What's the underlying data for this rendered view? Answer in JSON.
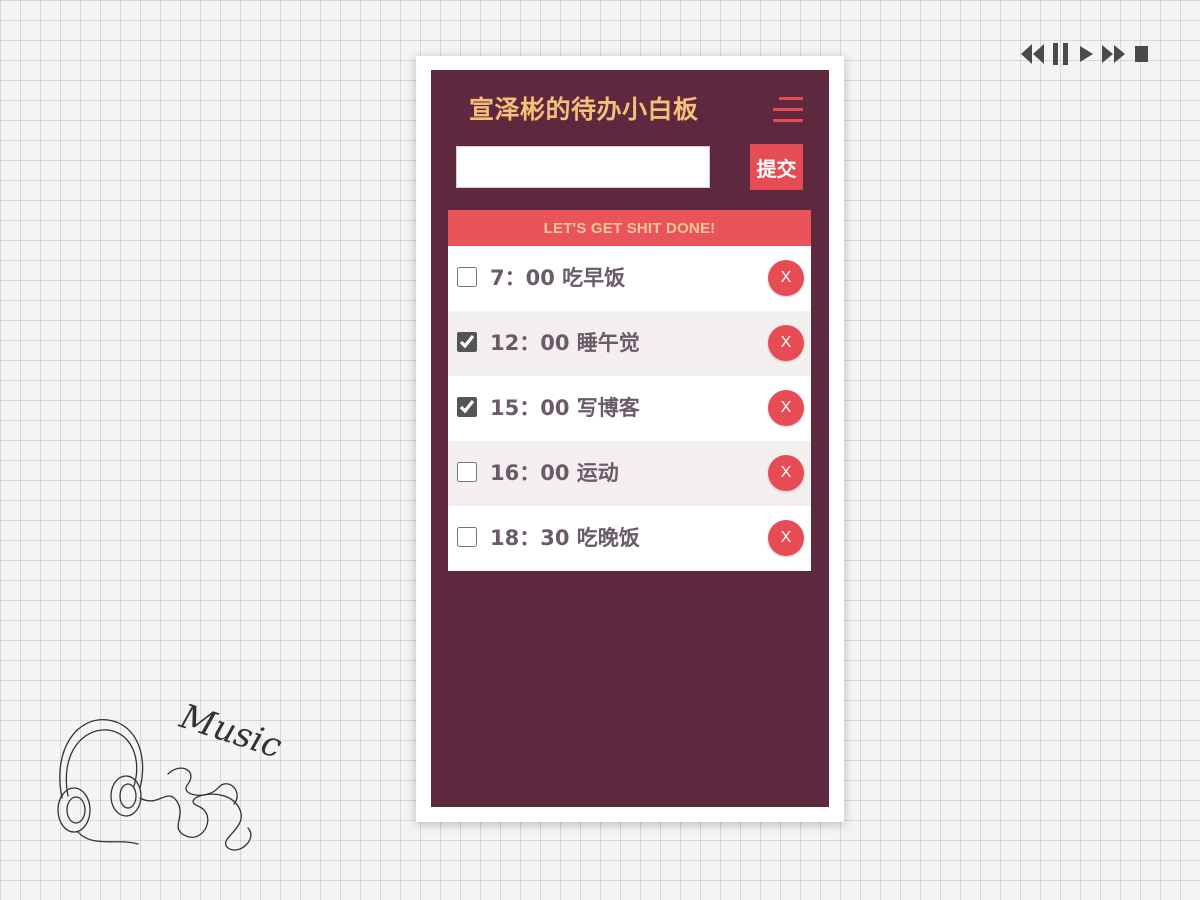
{
  "app": {
    "title": "宣泽彬的待办小白板",
    "input_placeholder": "",
    "submit_label": "提交",
    "list_header": "LET'S GET SHIT DONE!",
    "delete_label": "X"
  },
  "todos": [
    {
      "text": "7：00 吃早饭",
      "checked": false
    },
    {
      "text": "12：00 睡午觉",
      "checked": true
    },
    {
      "text": "15：00 写博客",
      "checked": true
    },
    {
      "text": "16：00 运动",
      "checked": false
    },
    {
      "text": "18：30 吃晚饭",
      "checked": false
    }
  ],
  "music": {
    "controls": [
      "rewind-icon",
      "pause-icon",
      "play-icon",
      "fast-forward-icon",
      "stop-icon"
    ],
    "doodle_text": "Music"
  },
  "colors": {
    "board": "#5e283f",
    "accent": "#e74c55",
    "title": "#f5c07a",
    "header_text": "#f7c59b",
    "item_text": "#6b5a68"
  }
}
